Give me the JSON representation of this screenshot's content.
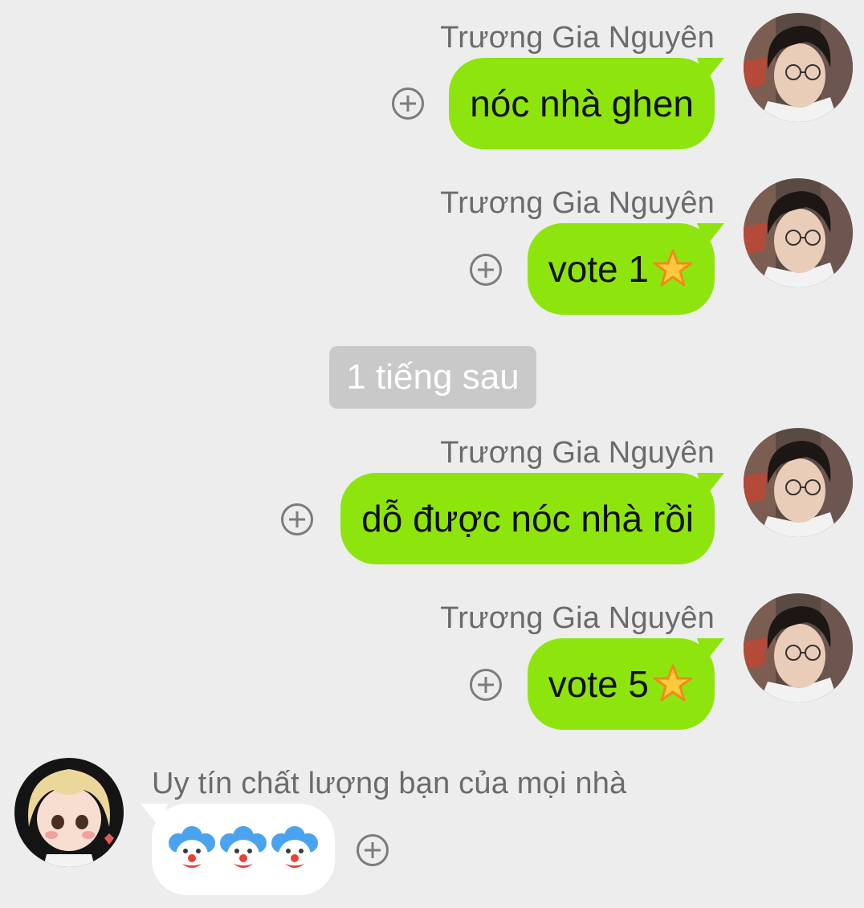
{
  "messages": [
    {
      "sender": "Trương Gia Nguyên",
      "text": "nóc nhà ghen"
    },
    {
      "sender": "Trương Gia Nguyên",
      "text": "vote 1",
      "emoji": "star"
    },
    {
      "sender": "Trương Gia Nguyên",
      "text": "dỗ được nóc nhà rồi"
    },
    {
      "sender": "Trương Gia Nguyên",
      "text": "vote 5",
      "emoji": "star"
    }
  ],
  "divider": {
    "text": "1 tiếng sau"
  },
  "incoming": {
    "sender": "Uy tín chất lượng bạn của mọi nhà",
    "emojis": [
      "clown-face",
      "clown-face",
      "clown-face"
    ]
  },
  "icons": {
    "react": "plus-circle-icon",
    "star": "star-icon"
  },
  "colors": {
    "background": "#ededed",
    "outgoing_bubble": "#8ee50e",
    "incoming_bubble": "#ffffff",
    "divider": "#c9c9c9"
  }
}
